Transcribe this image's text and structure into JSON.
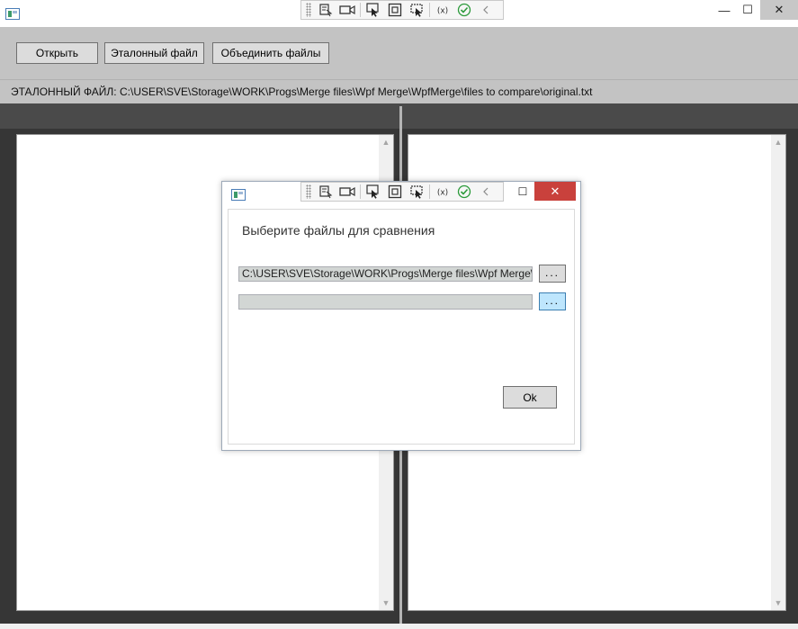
{
  "toolbar": {
    "open_label": "Открыть",
    "reference_label": "Эталонный файл",
    "merge_label": "Объединить файлы"
  },
  "path_bar": {
    "text": "ЭТАЛОННЫЙ ФАЙЛ: C:\\USER\\SVE\\Storage\\WORK\\Progs\\Merge files\\Wpf Merge\\WpfMerge\\files to compare\\original.txt"
  },
  "window_controls": {
    "minimize": "—",
    "maximize": "☐",
    "close": "✕"
  },
  "debug_toolbar": {
    "tools": [
      "select-element-icon",
      "record-icon",
      "pointer-icon",
      "layout-adorner-icon",
      "track-focus-icon",
      "binding-icon",
      "check-icon",
      "collapse-icon"
    ]
  },
  "dialog": {
    "prompt": "Выберите файлы для сравнения",
    "file1_value": "C:\\USER\\SVE\\Storage\\WORK\\Progs\\Merge files\\Wpf Merge\\WpfMerge\\files to compare\\original.txt",
    "file2_value": "",
    "browse_label": "...",
    "ok_label": "Ok",
    "close": "✕",
    "maximize": "☐"
  },
  "colors": {
    "chrome": "#c3c3c3",
    "dark_band": "#4a4a4a",
    "pane_background": "#363636",
    "close_red": "#c9413c",
    "browse_focus": "#bee6fd"
  }
}
